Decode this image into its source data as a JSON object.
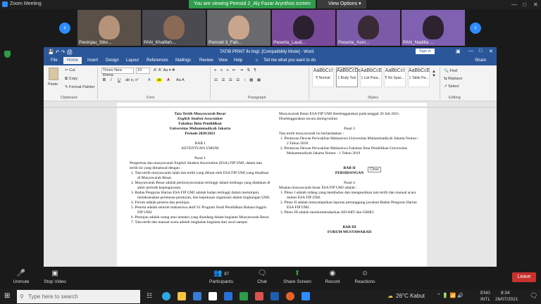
{
  "zoom": {
    "window_title": "Zoom Meeting",
    "banner": "You are viewing Pemsid 2_Aly Fazar Arynthos screen",
    "view_options": "View Options",
    "participants": [
      {
        "name": "Peninjau_Silvi..."
      },
      {
        "name": "PAN_Khalifah..."
      },
      {
        "name": "Pemsid 3_Fah..."
      },
      {
        "name": "Peserta_Laud..."
      },
      {
        "name": "Peserta_Asm..."
      },
      {
        "name": "PAN_Nadilla ..."
      }
    ],
    "controls": {
      "unmute": "Unmute",
      "stop_video": "Stop Video",
      "participants": "Participants",
      "participants_count": "87",
      "chat": "Chat",
      "share_screen": "Share Screen",
      "record": "Record",
      "reactions": "Reactions",
      "leave": "Leave"
    }
  },
  "word": {
    "doc_title": "TATIB PRINT fix lingt. [Compatibility Mode] - Word",
    "signin": "Sign in",
    "tabs": [
      "File",
      "Home",
      "Insert",
      "Design",
      "Layout",
      "References",
      "Mailings",
      "Review",
      "View",
      "Help"
    ],
    "tell_me": "Tell me what you want to do",
    "share": "Share",
    "clipboard": {
      "paste": "Paste",
      "cut": "Cut",
      "copy": "Copy",
      "format_painter": "Format Painter",
      "group": "Clipboard"
    },
    "font": {
      "name": "Times New Roma",
      "size": "10",
      "group": "Font"
    },
    "paragraph_group": "Paragraph",
    "styles_group": "Styles",
    "styles": [
      {
        "preview": "AaBbCcI",
        "label": "¶ Normal"
      },
      {
        "preview": "AaBbCcDd",
        "label": "1 Body Text"
      },
      {
        "preview": "AaBbCcE",
        "label": "1 List Para..."
      },
      {
        "preview": "AaBbCcI",
        "label": "¶ No Spac..."
      },
      {
        "preview": "AaBbCcE",
        "label": "1 Table Pa..."
      }
    ],
    "editing": {
      "find": "Find",
      "replace": "Replace",
      "select": "Select",
      "group": "Editing"
    },
    "tooltip": "Close",
    "left_column": [
      {
        "text": "Tata Tertib Musyawarah Besar",
        "style": "c b"
      },
      {
        "text": "English Student Association",
        "style": "c b i"
      },
      {
        "text": "Fakultas Ilmu Pendidikan",
        "style": "c b"
      },
      {
        "text": "Universitas Muhammadiyah Jakarta",
        "style": "c b"
      },
      {
        "text": "Periode 2020/2021",
        "style": "c b"
      },
      {
        "text": "",
        "style": ""
      },
      {
        "text": "BAB I",
        "style": "c"
      },
      {
        "text": "KETENTUAN UMUM",
        "style": "c"
      },
      {
        "text": "",
        "style": ""
      },
      {
        "text": "Pasal 1",
        "style": "c"
      },
      {
        "text": "Pengertian dan musyawarah English Student Association (ESA) FIP UMJ, dalam tata tertib ini yang dimaksud dengan :",
        "style": ""
      },
      {
        "text": "1.  Tata tertib musyawarah ialah tata tertib yang dibuat oleh ESA FIP UMJ yang disahkan di Musyawarah Besar.",
        "style": "li"
      },
      {
        "text": "2.  Musyawarah Besar adalah permusyawaratan tertinggi dalam lembaga yang diadakan di akhir periode kepengurusan.",
        "style": "li"
      },
      {
        "text": "3.  Badan Pengurus Harian ESA FIP UMJ adalah badan tertinggi dalam memimpin, melaksanakan peraturan-peraturan, dan keputusan organisasi dalam lingkungan UMJ.",
        "style": "li"
      },
      {
        "text": "4.  Forum adalah peserta dan peninjau.",
        "style": "li"
      },
      {
        "text": "5.  Peserta adalah seluruh mahasiswa aktif S1 Program Studi Pendidikan Bahasa Inggris FIP UMJ.",
        "style": "li"
      },
      {
        "text": "6.  Peninjau adalah orang atau instansi yang diundang dalam kegiatan Musyawarah Besar.",
        "style": "li"
      },
      {
        "text": "7.  Tata tertib dan manual acara adalah rangkaian kegiatan dari awal sampai",
        "style": "li"
      }
    ],
    "right_column": [
      {
        "text": "Musyawarah Besar ESA FIP UMJ diselenggarakan pada tanggal 26 Juli 2021. Diselenggarakan secara daring/online.",
        "style": ""
      },
      {
        "text": "",
        "style": ""
      },
      {
        "text": "Pasal 3",
        "style": "c"
      },
      {
        "text": "Tata tertib musyawarah ini berlandaskan :",
        "style": ""
      },
      {
        "text": "1.  Peraturan Dewan Perwakilan Mahasiswa Universitas Muhammadiyah Jakarta Nomor : 2 Tahun 2018",
        "style": "li"
      },
      {
        "text": "2.  Peraturan Dewan Perwakilan Mahasiswa Fakultas Ilmu Pendidikan Universitas Muhammadiyah Jakarta Nomor : 1 Tahun 2019",
        "style": "li"
      },
      {
        "text": "",
        "style": ""
      },
      {
        "text": "",
        "style": ""
      },
      {
        "text": "BAB II",
        "style": "c b"
      },
      {
        "text": "PERSIDANGAN",
        "style": "c b"
      },
      {
        "text": "",
        "style": ""
      },
      {
        "text": "Pasal 4",
        "style": "c"
      },
      {
        "text": "Muatan musyawarah besar ESA FIP UMJ adalah :",
        "style": ""
      },
      {
        "text": "1.  Pleno I adalah sidang yang membahas dan mengesahkan tata tertib dan manual acara mubes ESA FIP UMJ.",
        "style": "li"
      },
      {
        "text": "2.  Pleno II adalah menyampaikan laporan pertanggung jawaban Badan Pengurus Harian ESA FIP UMJ.",
        "style": "li"
      },
      {
        "text": "3.  Pleno III adalah merekomendasikan AD/ART dan GBHO.",
        "style": "li"
      },
      {
        "text": "",
        "style": ""
      },
      {
        "text": "",
        "style": ""
      },
      {
        "text": "BAB III",
        "style": "c b"
      },
      {
        "text": "FORUM MUSYAWARAH",
        "style": "c b"
      }
    ]
  },
  "taskbar": {
    "search_placeholder": "Type here to search",
    "weather": "26°C  Kabut",
    "lang": "ENG",
    "lang2": "INTL",
    "time": "8:34",
    "date": "26/07/2021"
  }
}
